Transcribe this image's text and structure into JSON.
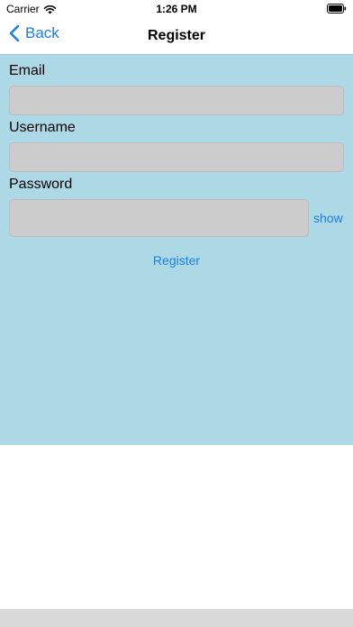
{
  "status_bar": {
    "carrier": "Carrier",
    "time": "1:26 PM"
  },
  "nav": {
    "back_label": "Back",
    "title": "Register"
  },
  "form": {
    "email_label": "Email",
    "email_value": "",
    "username_label": "Username",
    "username_value": "",
    "password_label": "Password",
    "password_value": "",
    "show_label": "show",
    "register_label": "Register"
  },
  "colors": {
    "accent": "#1a7fe0",
    "form_background": "#add8e6",
    "input_background": "#cccccc"
  },
  "icons": {
    "wifi": "wifi-icon",
    "battery": "battery-icon",
    "back": "chevron-left-icon"
  }
}
